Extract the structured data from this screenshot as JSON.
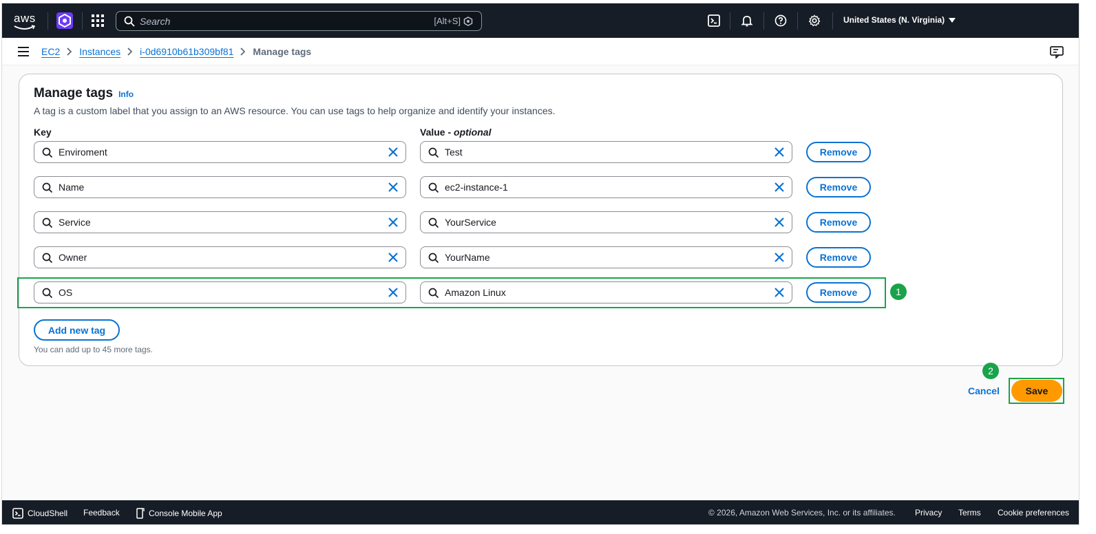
{
  "topnav": {
    "logo_text": "aws",
    "search_placeholder": "Search",
    "search_shortcut": "[Alt+S]",
    "region": "United States (N. Virginia)"
  },
  "breadcrumb": {
    "items": [
      "EC2",
      "Instances",
      "i-0d6910b61b309bf81"
    ],
    "current": "Manage tags"
  },
  "panel": {
    "title": "Manage tags",
    "info": "Info",
    "description": "A tag is a custom label that you assign to an AWS resource. You can use tags to help organize and identify your instances.",
    "key_label": "Key",
    "value_label": "Value - ",
    "value_optional": "optional",
    "remove_label": "Remove",
    "add_label": "Add new tag",
    "hint": "You can add up to 45 more tags."
  },
  "tags": [
    {
      "key": "Enviroment",
      "value": "Test"
    },
    {
      "key": "Name",
      "value": "ec2-instance-1"
    },
    {
      "key": "Service",
      "value": "YourService"
    },
    {
      "key": "Owner",
      "value": "YourName"
    },
    {
      "key": "OS",
      "value": "Amazon Linux"
    }
  ],
  "actions": {
    "cancel": "Cancel",
    "save": "Save"
  },
  "annotations": {
    "badge1": "1",
    "badge2": "2"
  },
  "footer": {
    "cloudshell": "CloudShell",
    "feedback": "Feedback",
    "mobile": "Console Mobile App",
    "copyright": "© 2026, Amazon Web Services, Inc. or its affiliates.",
    "privacy": "Privacy",
    "terms": "Terms",
    "cookies": "Cookie preferences"
  },
  "colors": {
    "nav_bg": "#161d26",
    "link": "#0972d3",
    "primary": "#ff9900",
    "highlight": "#1aa34a"
  }
}
